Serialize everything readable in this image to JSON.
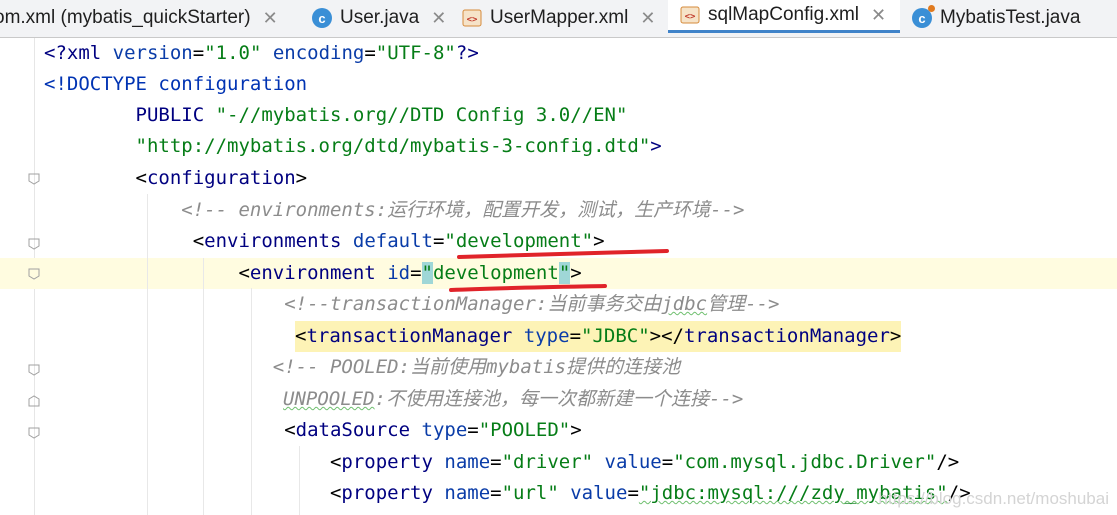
{
  "tabs": [
    {
      "label": "om.xml (mybatis_quickStarter)",
      "icon": "maven-xml-icon",
      "active": false
    },
    {
      "label": "User.java",
      "icon": "java-class-icon",
      "active": false
    },
    {
      "label": "UserMapper.xml",
      "icon": "xml-file-icon",
      "active": false
    },
    {
      "label": "sqlMapConfig.xml",
      "icon": "xml-file-icon",
      "active": true
    },
    {
      "label": "MybatisTest.java",
      "icon": "java-test-icon",
      "active": false
    }
  ],
  "close_glyph": "✕",
  "code": {
    "l1": {
      "a": "<?",
      "b": "xml ",
      "c": "version",
      "d": "=",
      "e": "\"1.0\"",
      "f": " encoding",
      "g": "=",
      "h": "\"UTF-8\"",
      "i": "?>"
    },
    "l2": {
      "a": "<!DOCTYPE configuration"
    },
    "l3": {
      "a": "        PUBLIC ",
      "b": "\"-//mybatis.org//DTD Config 3.0//EN\""
    },
    "l4": {
      "a": "        \"http://mybatis.org/dtd/mybatis-3-config.dtd\"",
      "b": ">"
    },
    "l5": {
      "a": "        <",
      "b": "configuration",
      "c": ">"
    },
    "l6": {
      "a": "            <!-- environments:运行环境，配置开发，测试，生产环境-->"
    },
    "l7": {
      "a": "             <",
      "b": "environments ",
      "c": "default",
      "d": "=",
      "e": "\"development\"",
      "f": ">"
    },
    "l8": {
      "a": "                 <",
      "b": "environment ",
      "c": "id",
      "d": "=",
      "e": "\"",
      "f": "development",
      "g": "\"",
      "h": ">"
    },
    "l9": {
      "a": "                     <!--transactionManager:当前事务交由",
      "b": "jdbc",
      "c": "管理-->"
    },
    "l10": {
      "a": "<",
      "b": "transactionManager ",
      "c": "type",
      "d": "=",
      "e": "\"JDBC\"",
      "f": "></",
      "g": "transactionManager",
      "h": ">"
    },
    "l11": {
      "a": "                    <!-- POOLED:当前使用mybatis提供的连接池"
    },
    "l12": {
      "a": "UNPOOLED",
      "b": ":不使用连接池，每一次都新建一个连接-->"
    },
    "l13": {
      "a": "                     <",
      "b": "dataSource ",
      "c": "type",
      "d": "=",
      "e": "\"POOLED\"",
      "f": ">"
    },
    "l14": {
      "a": "                         <",
      "b": "property ",
      "c": "name",
      "d": "=",
      "e": "\"driver\"",
      "f": " value",
      "g": "=",
      "h": "\"com.mysql.jdbc.Driver\"",
      "i": "/>"
    },
    "l15": {
      "a": "                         <",
      "b": "property ",
      "c": "name",
      "d": "=",
      "e": "\"url\"",
      "f": " value",
      "g": "=",
      "h": "\"jdbc:mysql:///zdy_mybatis\"",
      "i": "/>"
    }
  },
  "watermark": "https://blog.csdn.net/moshubai",
  "colors": {
    "tag": "#000080",
    "attribute": "#0a3ca8",
    "value": "#067d17",
    "comment": "#8c8c8c",
    "annotation_red": "#e0232a",
    "caret_line": "#fffce0",
    "active_tab_underline": "#4083c9"
  }
}
